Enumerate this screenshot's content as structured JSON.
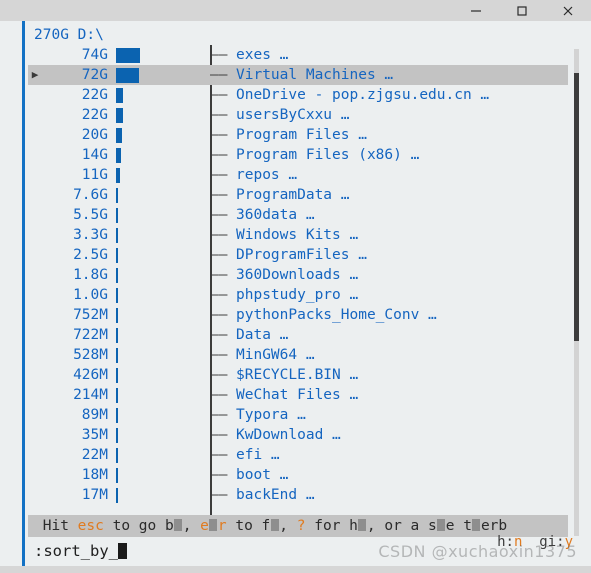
{
  "window": {
    "controls": [
      {
        "name": "minimize",
        "glyph": "minimize-icon"
      },
      {
        "name": "maximize",
        "glyph": "maximize-icon"
      },
      {
        "name": "close",
        "glyph": "close-icon"
      }
    ]
  },
  "header": {
    "total_size": "270G",
    "path": "D:\\",
    "line": "270G D:\\"
  },
  "colors": {
    "accent_blue": "#1271c4",
    "bar_blue": "#0b63b0",
    "text_blue": "#1565c0",
    "selection_grey": "#c3c3c3",
    "key_orange": "#e07b20",
    "terminal_bg": "#eceff0",
    "titlebar_bg": "#d6d6d6"
  },
  "chart_data": {
    "type": "bar",
    "title": "270G D:\\",
    "xlabel": "",
    "ylabel": "",
    "orientation": "horizontal",
    "unit": "bytes (human readable)",
    "categories": [
      "exes",
      "Virtual Machines",
      "OneDrive - pop.zjgsu.edu.cn",
      "usersByCxxu",
      "Program Files",
      "Program Files (x86)",
      "repos",
      "ProgramData",
      "360data",
      "Windows Kits",
      "DProgramFiles",
      "360Downloads",
      "phpstudy_pro",
      "pythonPacks_Home_Conv",
      "Data",
      "MinGW64",
      "$RECYCLE.BIN",
      "WeChat Files",
      "Typora",
      "KwDownload",
      "efi",
      "boot",
      "backEnd"
    ],
    "value_labels": [
      "74G",
      "72G",
      "22G",
      "22G",
      "20G",
      "14G",
      "11G",
      "7.6G",
      "5.5G",
      "3.3G",
      "2.5G",
      "1.8G",
      "1.0G",
      "752M",
      "722M",
      "528M",
      "426M",
      "214M",
      "89M",
      "35M",
      "22M",
      "18M",
      "17M"
    ],
    "values": [
      74,
      72,
      22,
      22,
      20,
      14,
      11,
      7.6,
      5.5,
      3.3,
      2.5,
      1.8,
      1.0,
      0.734,
      0.705,
      0.516,
      0.416,
      0.209,
      0.087,
      0.034,
      0.021,
      0.018,
      0.017
    ],
    "max_value": 74,
    "grid": false,
    "legend": "none"
  },
  "rows": [
    {
      "cursor": "▶",
      "size": "74G",
      "bar_pct": 100,
      "name": "exes …",
      "selected": false,
      "show_cursor": false
    },
    {
      "cursor": "▶",
      "size": "72G",
      "bar_pct": 97.3,
      "name": "Virtual Machines …",
      "selected": true,
      "show_cursor": true
    },
    {
      "cursor": "▶",
      "size": "22G",
      "bar_pct": 29.7,
      "name": "OneDrive - pop.zjgsu.edu.cn …",
      "selected": false,
      "show_cursor": false
    },
    {
      "cursor": "▶",
      "size": "22G",
      "bar_pct": 29.7,
      "name": "usersByCxxu …",
      "selected": false,
      "show_cursor": false
    },
    {
      "cursor": "▶",
      "size": "20G",
      "bar_pct": 27.0,
      "name": "Program Files …",
      "selected": false,
      "show_cursor": false
    },
    {
      "cursor": "▶",
      "size": "14G",
      "bar_pct": 18.9,
      "name": "Program Files (x86) …",
      "selected": false,
      "show_cursor": false
    },
    {
      "cursor": "▶",
      "size": "11G",
      "bar_pct": 14.9,
      "name": "repos …",
      "selected": false,
      "show_cursor": false
    },
    {
      "cursor": "▶",
      "size": "7.6G",
      "bar_pct": 10.3,
      "name": "ProgramData …",
      "selected": false,
      "show_cursor": false
    },
    {
      "cursor": "▶",
      "size": "5.5G",
      "bar_pct": 7.4,
      "name": "360data …",
      "selected": false,
      "show_cursor": false
    },
    {
      "cursor": "▶",
      "size": "3.3G",
      "bar_pct": 4.5,
      "name": "Windows Kits …",
      "selected": false,
      "show_cursor": false
    },
    {
      "cursor": "▶",
      "size": "2.5G",
      "bar_pct": 3.4,
      "name": "DProgramFiles …",
      "selected": false,
      "show_cursor": false
    },
    {
      "cursor": "▶",
      "size": "1.8G",
      "bar_pct": 2.4,
      "name": "360Downloads …",
      "selected": false,
      "show_cursor": false
    },
    {
      "cursor": "▶",
      "size": "1.0G",
      "bar_pct": 1.4,
      "name": "phpstudy_pro …",
      "selected": false,
      "show_cursor": false
    },
    {
      "cursor": "▶",
      "size": "752M",
      "bar_pct": 1.0,
      "name": "pythonPacks_Home_Conv …",
      "selected": false,
      "show_cursor": false
    },
    {
      "cursor": "▶",
      "size": "722M",
      "bar_pct": 0.95,
      "name": "Data …",
      "selected": false,
      "show_cursor": false
    },
    {
      "cursor": "▶",
      "size": "528M",
      "bar_pct": 0.7,
      "name": "MinGW64 …",
      "selected": false,
      "show_cursor": false
    },
    {
      "cursor": "▶",
      "size": "426M",
      "bar_pct": 0.56,
      "name": "$RECYCLE.BIN …",
      "selected": false,
      "show_cursor": false
    },
    {
      "cursor": "▶",
      "size": "214M",
      "bar_pct": 0.28,
      "name": "WeChat Files …",
      "selected": false,
      "show_cursor": false
    },
    {
      "cursor": "▶",
      "size": "89M",
      "bar_pct": 0.12,
      "name": "Typora …",
      "selected": false,
      "show_cursor": false
    },
    {
      "cursor": "▶",
      "size": "35M",
      "bar_pct": 0.05,
      "name": "KwDownload …",
      "selected": false,
      "show_cursor": false
    },
    {
      "cursor": "▶",
      "size": "22M",
      "bar_pct": 0.03,
      "name": "efi …",
      "selected": false,
      "show_cursor": false
    },
    {
      "cursor": "▶",
      "size": "18M",
      "bar_pct": 0.02,
      "name": "boot …",
      "selected": false,
      "show_cursor": false
    },
    {
      "cursor": "▶",
      "size": "17M",
      "bar_pct": 0.02,
      "name": "backEnd …",
      "selected": false,
      "show_cursor": false
    }
  ],
  "scrollbar": {
    "thumb_top_pct": 5,
    "thumb_height_pct": 55
  },
  "statusbar": {
    "segments": [
      {
        "text": " Hit ",
        "style": "plain"
      },
      {
        "text": "esc",
        "style": "key"
      },
      {
        "text": " to go b",
        "style": "plain"
      },
      {
        "text": "",
        "style": "block"
      },
      {
        "text": ", ",
        "style": "plain"
      },
      {
        "text": "e",
        "style": "key"
      },
      {
        "text": "",
        "style": "block"
      },
      {
        "text": "r",
        "style": "key"
      },
      {
        "text": " to f",
        "style": "plain"
      },
      {
        "text": "",
        "style": "block"
      },
      {
        "text": ", ",
        "style": "plain"
      },
      {
        "text": "?",
        "style": "key"
      },
      {
        "text": " for h",
        "style": "plain"
      },
      {
        "text": "",
        "style": "block"
      },
      {
        "text": ", or a s",
        "style": "plain"
      },
      {
        "text": "",
        "style": "block"
      },
      {
        "text": "e t",
        "style": "plain"
      },
      {
        "text": "",
        "style": "block"
      },
      {
        "text": "erb",
        "style": "plain"
      }
    ],
    "plain_text": "Hit esc to go b.., e..r to f.., ? for h.., or a s..e t..erb"
  },
  "command_line": {
    "prompt": ":",
    "text": "sort_by_",
    "full": ":sort_by_"
  },
  "status_right": {
    "items": [
      {
        "label": "h:",
        "value": "n"
      },
      {
        "label": "gi:",
        "value": "y"
      }
    ],
    "text": "h:n  gi:y"
  },
  "watermark": {
    "text": "CSDN @xuchaoxin1375"
  }
}
